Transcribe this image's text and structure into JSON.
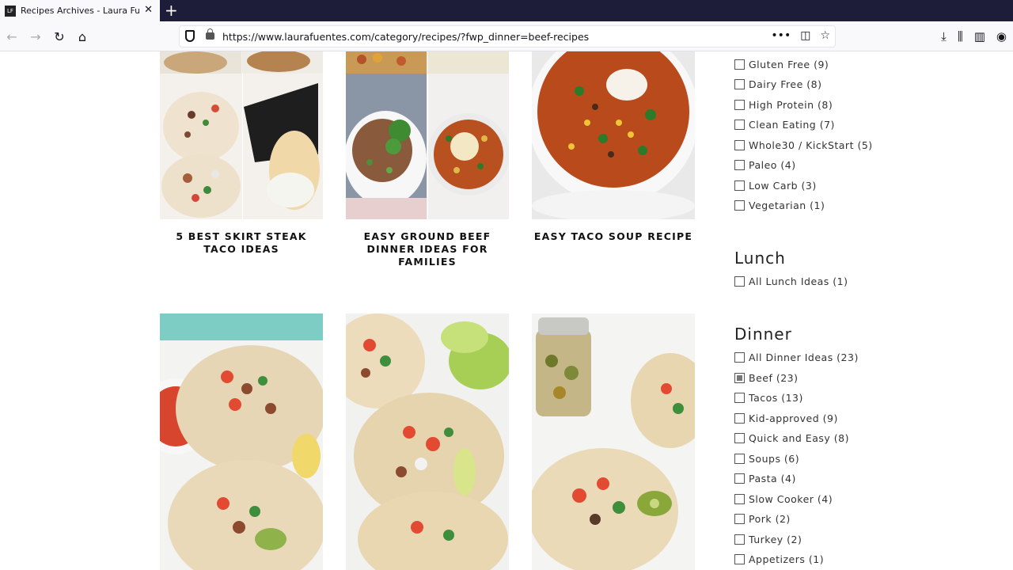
{
  "browser": {
    "tab_title": "Recipes Archives - Laura Fuentes",
    "favicon_text": "LF",
    "tab_close": "✕",
    "new_tab": "+",
    "url": "https://www.laurafuentes.com/category/recipes/?fwp_dinner=beef-recipes",
    "nav": {
      "back": "←",
      "forward": "→",
      "reload": "↻",
      "home": "⌂"
    },
    "url_actions": [
      "•••",
      "◫",
      "☆"
    ],
    "toolbar_icons": [
      "⤓",
      "⫼",
      "▥",
      "◉"
    ]
  },
  "recipes": [
    {
      "title": "5 BEST SKIRT STEAK TACO IDEAS"
    },
    {
      "title": "EASY GROUND BEEF DINNER IDEAS FOR FAMILIES"
    },
    {
      "title": "EASY TACO SOUP RECIPE"
    },
    {
      "title": ""
    },
    {
      "title": ""
    },
    {
      "title": ""
    }
  ],
  "sidebar": {
    "diet_filters": [
      {
        "label": "Gluten Free (9)",
        "checked": false
      },
      {
        "label": "Dairy Free (8)",
        "checked": false
      },
      {
        "label": "High Protein (8)",
        "checked": false
      },
      {
        "label": "Clean Eating (7)",
        "checked": false
      },
      {
        "label": "Whole30 / KickStart (5)",
        "checked": false
      },
      {
        "label": "Paleo (4)",
        "checked": false
      },
      {
        "label": "Low Carb (3)",
        "checked": false
      },
      {
        "label": "Vegetarian (1)",
        "checked": false
      }
    ],
    "lunch": {
      "heading": "Lunch",
      "filters": [
        {
          "label": "All Lunch Ideas (1)",
          "checked": false
        }
      ]
    },
    "dinner": {
      "heading": "Dinner",
      "filters": [
        {
          "label": "All Dinner Ideas (23)",
          "checked": false
        },
        {
          "label": "Beef (23)",
          "checked": true
        },
        {
          "label": "Tacos (13)",
          "checked": false
        },
        {
          "label": "Kid-approved (9)",
          "checked": false
        },
        {
          "label": "Quick and Easy (8)",
          "checked": false
        },
        {
          "label": "Soups (6)",
          "checked": false
        },
        {
          "label": "Pasta (4)",
          "checked": false
        },
        {
          "label": "Slow Cooker (4)",
          "checked": false
        },
        {
          "label": "Pork (2)",
          "checked": false
        },
        {
          "label": "Turkey (2)",
          "checked": false
        },
        {
          "label": "Appetizers (1)",
          "checked": false
        }
      ]
    }
  }
}
